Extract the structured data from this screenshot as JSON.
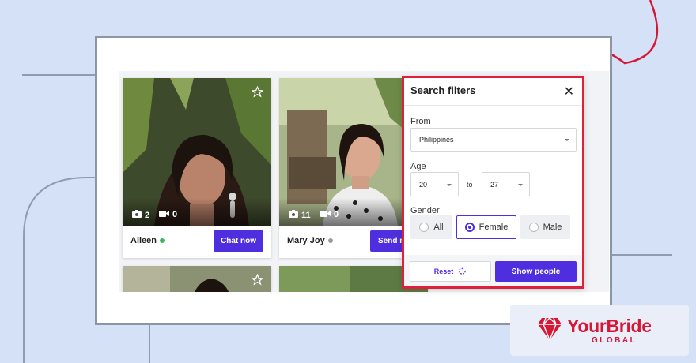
{
  "cards": [
    {
      "name": "Aileen",
      "photos": "2",
      "videos": "0",
      "online_color": "#3bb75e",
      "button": "Chat now"
    },
    {
      "name": "Mary Joy",
      "photos": "11",
      "videos": "0",
      "online_color": "#9a9a9a",
      "button": "Send m"
    }
  ],
  "filters": {
    "title": "Search filters",
    "from_label": "From",
    "from_value": "Philippines",
    "age_label": "Age",
    "age_min": "20",
    "age_to": "to",
    "age_max": "27",
    "gender_label": "Gender",
    "gender_options": [
      "All",
      "Female",
      "Male"
    ],
    "gender_selected": "Female",
    "reset_label": "Reset",
    "show_label": "Show people"
  },
  "brand": {
    "name": "YourBride",
    "sub": "GLOBAL",
    "color": "#d51836"
  },
  "colors": {
    "accent": "#4f2ee0",
    "highlight": "#e0203a"
  }
}
